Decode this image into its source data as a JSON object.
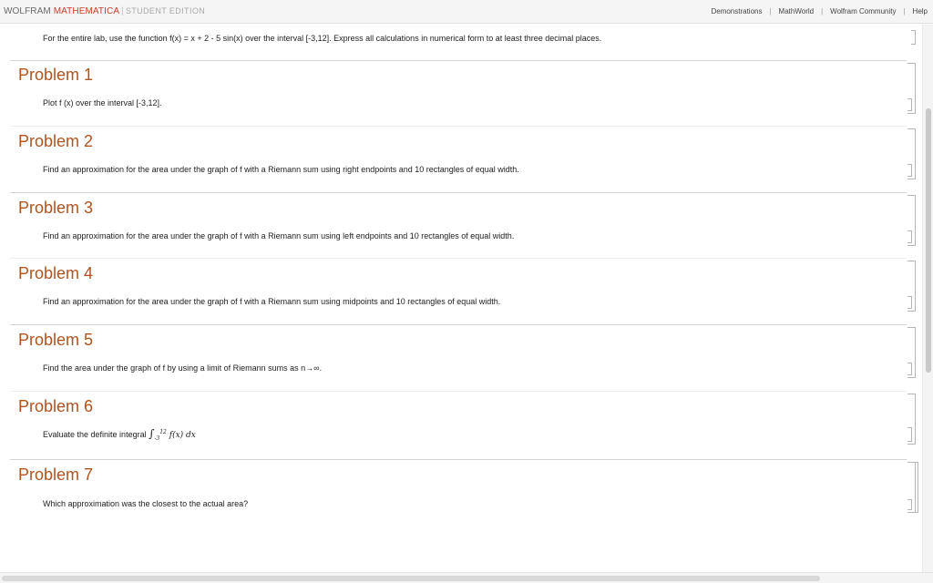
{
  "header": {
    "brand_wolfram": "WOLFRAM",
    "brand_mathematica": "MATHEMATICA",
    "brand_edition": "STUDENT EDITION",
    "links": [
      "Demonstrations",
      "MathWorld",
      "Wolfram Community",
      "Help"
    ]
  },
  "intro": "For the entire lab,  use the function f(x) = x + 2 - 5 sin(x) over the interval [-3,12].  Express all calculations in numerical form to at least three decimal places.",
  "problems": [
    {
      "title": "Problem 1",
      "text": "Plot f (x) over the interval [-3,12]."
    },
    {
      "title": "Problem 2",
      "text": "Find an approximation for the area under the graph of f with a Riemann sum using right endpoints and 10 rectangles of equal width."
    },
    {
      "title": "Problem 3",
      "text": "Find an approximation for the area under the graph of f with a Riemann sum using left endpoints and 10 rectangles of equal width."
    },
    {
      "title": "Problem 4",
      "text": "Find an approximation for the area under the graph of f with a Riemann sum using midpoints and 10 rectangles of equal width."
    },
    {
      "title": "Problem 5",
      "text": "Find the area under the graph of f by using a limit of Riemann sums as n→∞."
    },
    {
      "title": "Problem 6",
      "text": "Evaluate the definite integral",
      "integral_upper": "12",
      "integral_lower": "-3",
      "integral_body": "f(x) dx"
    },
    {
      "title": "Problem 7",
      "text": "Which approximation was the closest to the actual area?"
    }
  ],
  "colors": {
    "section_title": "#b2531f",
    "brand_accent": "#c9402a",
    "cell_bracket": "#b5b5b5"
  }
}
